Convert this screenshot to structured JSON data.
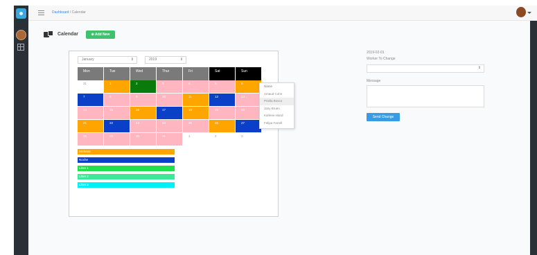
{
  "breadcrumb": {
    "home": "Dashboard",
    "separator": "/",
    "current": "Calendar"
  },
  "header": {
    "title": "Calendar",
    "add_button": "Add New"
  },
  "filters": {
    "month": "January",
    "year": "2019"
  },
  "calendar": {
    "days": [
      {
        "label": "Mon",
        "color": "#7a7a7a"
      },
      {
        "label": "Tue",
        "color": "#7a7a7a"
      },
      {
        "label": "Wed",
        "color": "#7a7a7a"
      },
      {
        "label": "Thur",
        "color": "#7a7a7a"
      },
      {
        "label": "Fri",
        "color": "#7a7a7a"
      },
      {
        "label": "Sat",
        "color": "#000000"
      },
      {
        "label": "Sun",
        "color": "#000000"
      }
    ],
    "weeks": [
      [
        {
          "day": "31",
          "color": "#ffffff",
          "text": "#999999"
        },
        {
          "day": "1",
          "color": "#ffa500",
          "text": "#ffffff"
        },
        {
          "day": "2",
          "color": "#0a7a0a",
          "text": "#ffffff"
        },
        {
          "day": "3",
          "color": "#ffb6c1",
          "text": "#ffffff"
        },
        {
          "day": "4",
          "color": "#ffb6c1",
          "text": "#ffffff"
        },
        {
          "day": "5",
          "color": "#ffb6c1",
          "text": "#ffffff"
        },
        {
          "day": "6",
          "color": "#ffa500",
          "text": "#ffffff"
        }
      ],
      [
        {
          "day": "7",
          "color": "#0a3fc8",
          "text": "#ffffff"
        },
        {
          "day": "8",
          "color": "#ffb6c1",
          "text": "#ffffff"
        },
        {
          "day": "9",
          "color": "#ffb6c1",
          "text": "#ffffff"
        },
        {
          "day": "10",
          "color": "#ffb6c1",
          "text": "#ffffff"
        },
        {
          "day": "11",
          "color": "#ffa500",
          "text": "#ffffff"
        },
        {
          "day": "12",
          "color": "#0a3fc8",
          "text": "#ffffff"
        },
        {
          "day": "13",
          "color": "#ffb6c1",
          "text": "#ffffff"
        }
      ],
      [
        {
          "day": "14",
          "color": "#ffb6c1",
          "text": "#ffffff"
        },
        {
          "day": "15",
          "color": "#ffb6c1",
          "text": "#ffffff"
        },
        {
          "day": "16",
          "color": "#ffa500",
          "text": "#ffffff"
        },
        {
          "day": "17",
          "color": "#0a3fc8",
          "text": "#ffffff"
        },
        {
          "day": "18",
          "color": "#ffa500",
          "text": "#ffffff"
        },
        {
          "day": "19",
          "color": "#ffb6c1",
          "text": "#ffffff"
        },
        {
          "day": "20",
          "color": "#ffb6c1",
          "text": "#ffffff"
        }
      ],
      [
        {
          "day": "21",
          "color": "#ffa500",
          "text": "#ffffff"
        },
        {
          "day": "22",
          "color": "#0a3fc8",
          "text": "#ffffff"
        },
        {
          "day": "23",
          "color": "#ffb6c1",
          "text": "#ffffff"
        },
        {
          "day": "24",
          "color": "#ffb6c1",
          "text": "#ffffff"
        },
        {
          "day": "25",
          "color": "#ffb6c1",
          "text": "#ffffff"
        },
        {
          "day": "26",
          "color": "#ffa500",
          "text": "#ffffff"
        },
        {
          "day": "27",
          "color": "#0a3fc8",
          "text": "#ffffff"
        }
      ],
      [
        {
          "day": "28",
          "color": "#ffb6c1",
          "text": "#ffffff"
        },
        {
          "day": "29",
          "color": "#ffb6c1",
          "text": "#ffffff"
        },
        {
          "day": "30",
          "color": "#ffb6c1",
          "text": "#ffffff"
        },
        {
          "day": "31",
          "color": "#ffb6c1",
          "text": "#ffffff"
        },
        {
          "day": "1",
          "color": "#ffffff",
          "text": "#999999"
        },
        {
          "day": "2",
          "color": "#ffffff",
          "text": "#999999"
        },
        {
          "day": "3",
          "color": "#ffffff",
          "text": "#999999"
        }
      ]
    ]
  },
  "legend": [
    {
      "label": "Stefania",
      "color": "#ffa500"
    },
    {
      "label": "Noche",
      "color": "#0a3fc8"
    },
    {
      "label": "Libre 1",
      "color": "#22e04a"
    },
    {
      "label": "Libre 2",
      "color": "#3ee899"
    },
    {
      "label": "Libre 3",
      "color": "#00f0f7"
    }
  ],
  "context_menu": {
    "header": "Name",
    "items": [
      "Amaud Cohn",
      "Priella Bosco",
      "Jany Bruen",
      "Karlene Hand",
      "Felipa Farrell"
    ]
  },
  "form": {
    "date": "2019-02-01",
    "worker_label": "Worker To Change",
    "message_label": "Message",
    "send_button": "Send Change"
  }
}
